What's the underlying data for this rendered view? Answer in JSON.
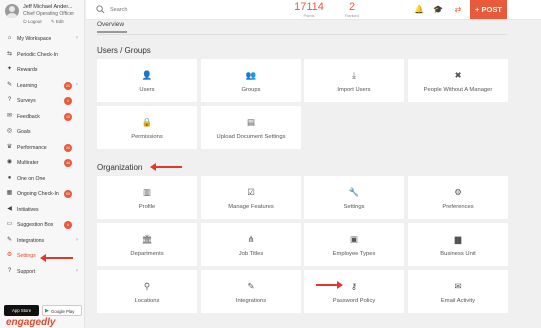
{
  "user": {
    "name": "Jeff Michael Ander...",
    "title": "Chief Operating Officer",
    "logout": "Logout",
    "edit": "Edit"
  },
  "nav": [
    {
      "label": "My Workspace",
      "icon": "⌂",
      "badge": "",
      "chevron": true
    },
    {
      "label": "Periodic Check-In",
      "icon": "⇆",
      "badge": "",
      "chevron": false
    },
    {
      "label": "Rewards",
      "icon": "✦",
      "badge": "",
      "chevron": false
    },
    {
      "label": "Learning",
      "icon": "✎",
      "badge": "24",
      "chevron": true
    },
    {
      "label": "Surveys",
      "icon": "?",
      "badge": "1",
      "chevron": false
    },
    {
      "label": "Feedback",
      "icon": "✉",
      "badge": "10",
      "chevron": false
    },
    {
      "label": "Goals",
      "icon": "◎",
      "badge": "",
      "chevron": false
    },
    {
      "label": "Performance",
      "icon": "♛",
      "badge": "24",
      "chevron": false
    },
    {
      "label": "Multirater",
      "icon": "◉",
      "badge": "44",
      "chevron": false
    },
    {
      "label": "One on One",
      "icon": "●",
      "badge": "",
      "chevron": false
    },
    {
      "label": "Ongoing Check-In",
      "icon": "▦",
      "badge": "60",
      "chevron": false
    },
    {
      "label": "Initiatives",
      "icon": "◀",
      "badge": "",
      "chevron": false
    },
    {
      "label": "Suggestion Box",
      "icon": "▭",
      "badge": "4",
      "chevron": false
    },
    {
      "label": "Integrations",
      "icon": "✎",
      "badge": "",
      "chevron": true
    },
    {
      "label": "Settings",
      "icon": "⚙",
      "badge": "",
      "chevron": false,
      "active": true
    },
    {
      "label": "Support",
      "icon": "?",
      "badge": "",
      "chevron": true
    }
  ],
  "stores": {
    "appstore": "App Store",
    "googleplay": "Google Play"
  },
  "brand": "engagedly",
  "topbar": {
    "search_placeholder": "Search",
    "points_value": "17114",
    "points_caption": "Points",
    "ranked_value": "2",
    "ranked_caption": "Ranked",
    "post_label": "+ POST"
  },
  "main": {
    "tab": "Overview",
    "section1": "Users / Groups",
    "section2": "Organization",
    "tiles": [
      {
        "label": "Users",
        "icon": "👤"
      },
      {
        "label": "Groups",
        "icon": "👥"
      },
      {
        "label": "Import Users",
        "icon": "⤓"
      },
      {
        "label": "People Without A Manager",
        "icon": "✖"
      },
      {
        "label": "Permissions",
        "icon": "🔒"
      },
      {
        "label": "Upload Document Settings",
        "icon": "▤"
      },
      {
        "label": "Profile",
        "icon": "▥"
      },
      {
        "label": "Manage Features",
        "icon": "☑"
      },
      {
        "label": "Settings",
        "icon": "🔧"
      },
      {
        "label": "Preferences",
        "icon": "⚙"
      },
      {
        "label": "Departments",
        "icon": "🏛"
      },
      {
        "label": "Job Titles",
        "icon": "⋔"
      },
      {
        "label": "Employee Types",
        "icon": "▣"
      },
      {
        "label": "Business Unit",
        "icon": "▆"
      },
      {
        "label": "Locations",
        "icon": "⚲"
      },
      {
        "label": "Integrations",
        "icon": "✎"
      },
      {
        "label": "Password Policy",
        "icon": "⚷"
      },
      {
        "label": "Email Activity",
        "icon": "✉"
      }
    ]
  },
  "colors": {
    "accent": "#e95a3a",
    "arrow": "#e0392a"
  }
}
